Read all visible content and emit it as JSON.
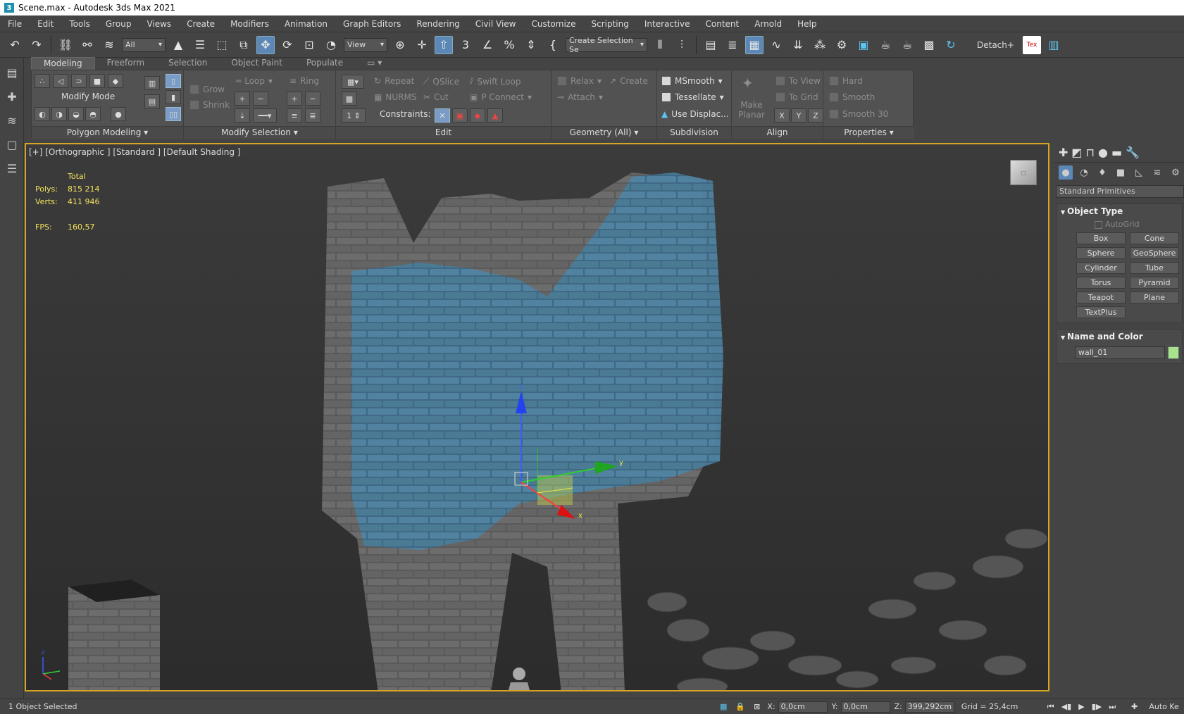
{
  "title": "Scene.max - Autodesk 3ds Max 2021",
  "menu": [
    "File",
    "Edit",
    "Tools",
    "Group",
    "Views",
    "Create",
    "Modifiers",
    "Animation",
    "Graph Editors",
    "Rendering",
    "Civil View",
    "Customize",
    "Scripting",
    "Interactive",
    "Content",
    "Arnold",
    "Help"
  ],
  "toolbar": {
    "filter": "All",
    "refcoord": "View",
    "selset": "Create Selection Se",
    "detach": "Detach+"
  },
  "ribbon": {
    "tabs": [
      "Modeling",
      "Freeform",
      "Selection",
      "Object Paint",
      "Populate"
    ],
    "modify_mode": "Modify Mode",
    "grow": "Grow",
    "shrink": "Shrink",
    "loop": "Loop",
    "ring": "Ring",
    "spinner": "1",
    "repeat": "Repeat",
    "qslice": "QSlice",
    "swift_loop": "Swift Loop",
    "nurms": "NURMS",
    "cut": "Cut",
    "p_connect": "P Connect",
    "constraints": "Constraints:",
    "relax": "Relax",
    "create": "Create",
    "attach": "Attach",
    "msmooth": "MSmooth",
    "tessellate": "Tessellate",
    "use_displace": "Use Displac...",
    "make_planar": "Make Planar",
    "to_view": "To View",
    "to_grid": "To Grid",
    "x": "X",
    "y": "Y",
    "z": "Z",
    "hard": "Hard",
    "smooth": "Smooth",
    "smooth30": "Smooth 30",
    "panels": [
      "Polygon Modeling",
      "Modify Selection",
      "Edit",
      "Geometry (All)",
      "Subdivision",
      "Align",
      "Properties"
    ]
  },
  "viewport": {
    "label": "[+] [Orthographic ] [Standard ] [Default Shading ]",
    "total": "Total",
    "polys_label": "Polys:",
    "polys": "815 214",
    "verts_label": "Verts:",
    "verts": "411 946",
    "fps_label": "FPS:",
    "fps": "160,57",
    "axis_x": "x",
    "axis_y": "y",
    "axis_z": "z"
  },
  "command_panel": {
    "dropdown": "Standard Primitives",
    "object_type": "Object Type",
    "autogrid": "AutoGrid",
    "primitives": [
      "Box",
      "Cone",
      "Sphere",
      "GeoSphere",
      "Cylinder",
      "Tube",
      "Torus",
      "Pyramid",
      "Teapot",
      "Plane",
      "TextPlus"
    ],
    "name_and_color": "Name and Color",
    "object_name": "wall_01",
    "object_color": "#a8e28c"
  },
  "status": {
    "selected": "1 Object Selected",
    "x_label": "X:",
    "x": "0,0cm",
    "y_label": "Y:",
    "y": "0,0cm",
    "z_label": "Z:",
    "z": "399,292cm",
    "grid": "Grid = 25,4cm",
    "autokey": "Auto Ke"
  }
}
